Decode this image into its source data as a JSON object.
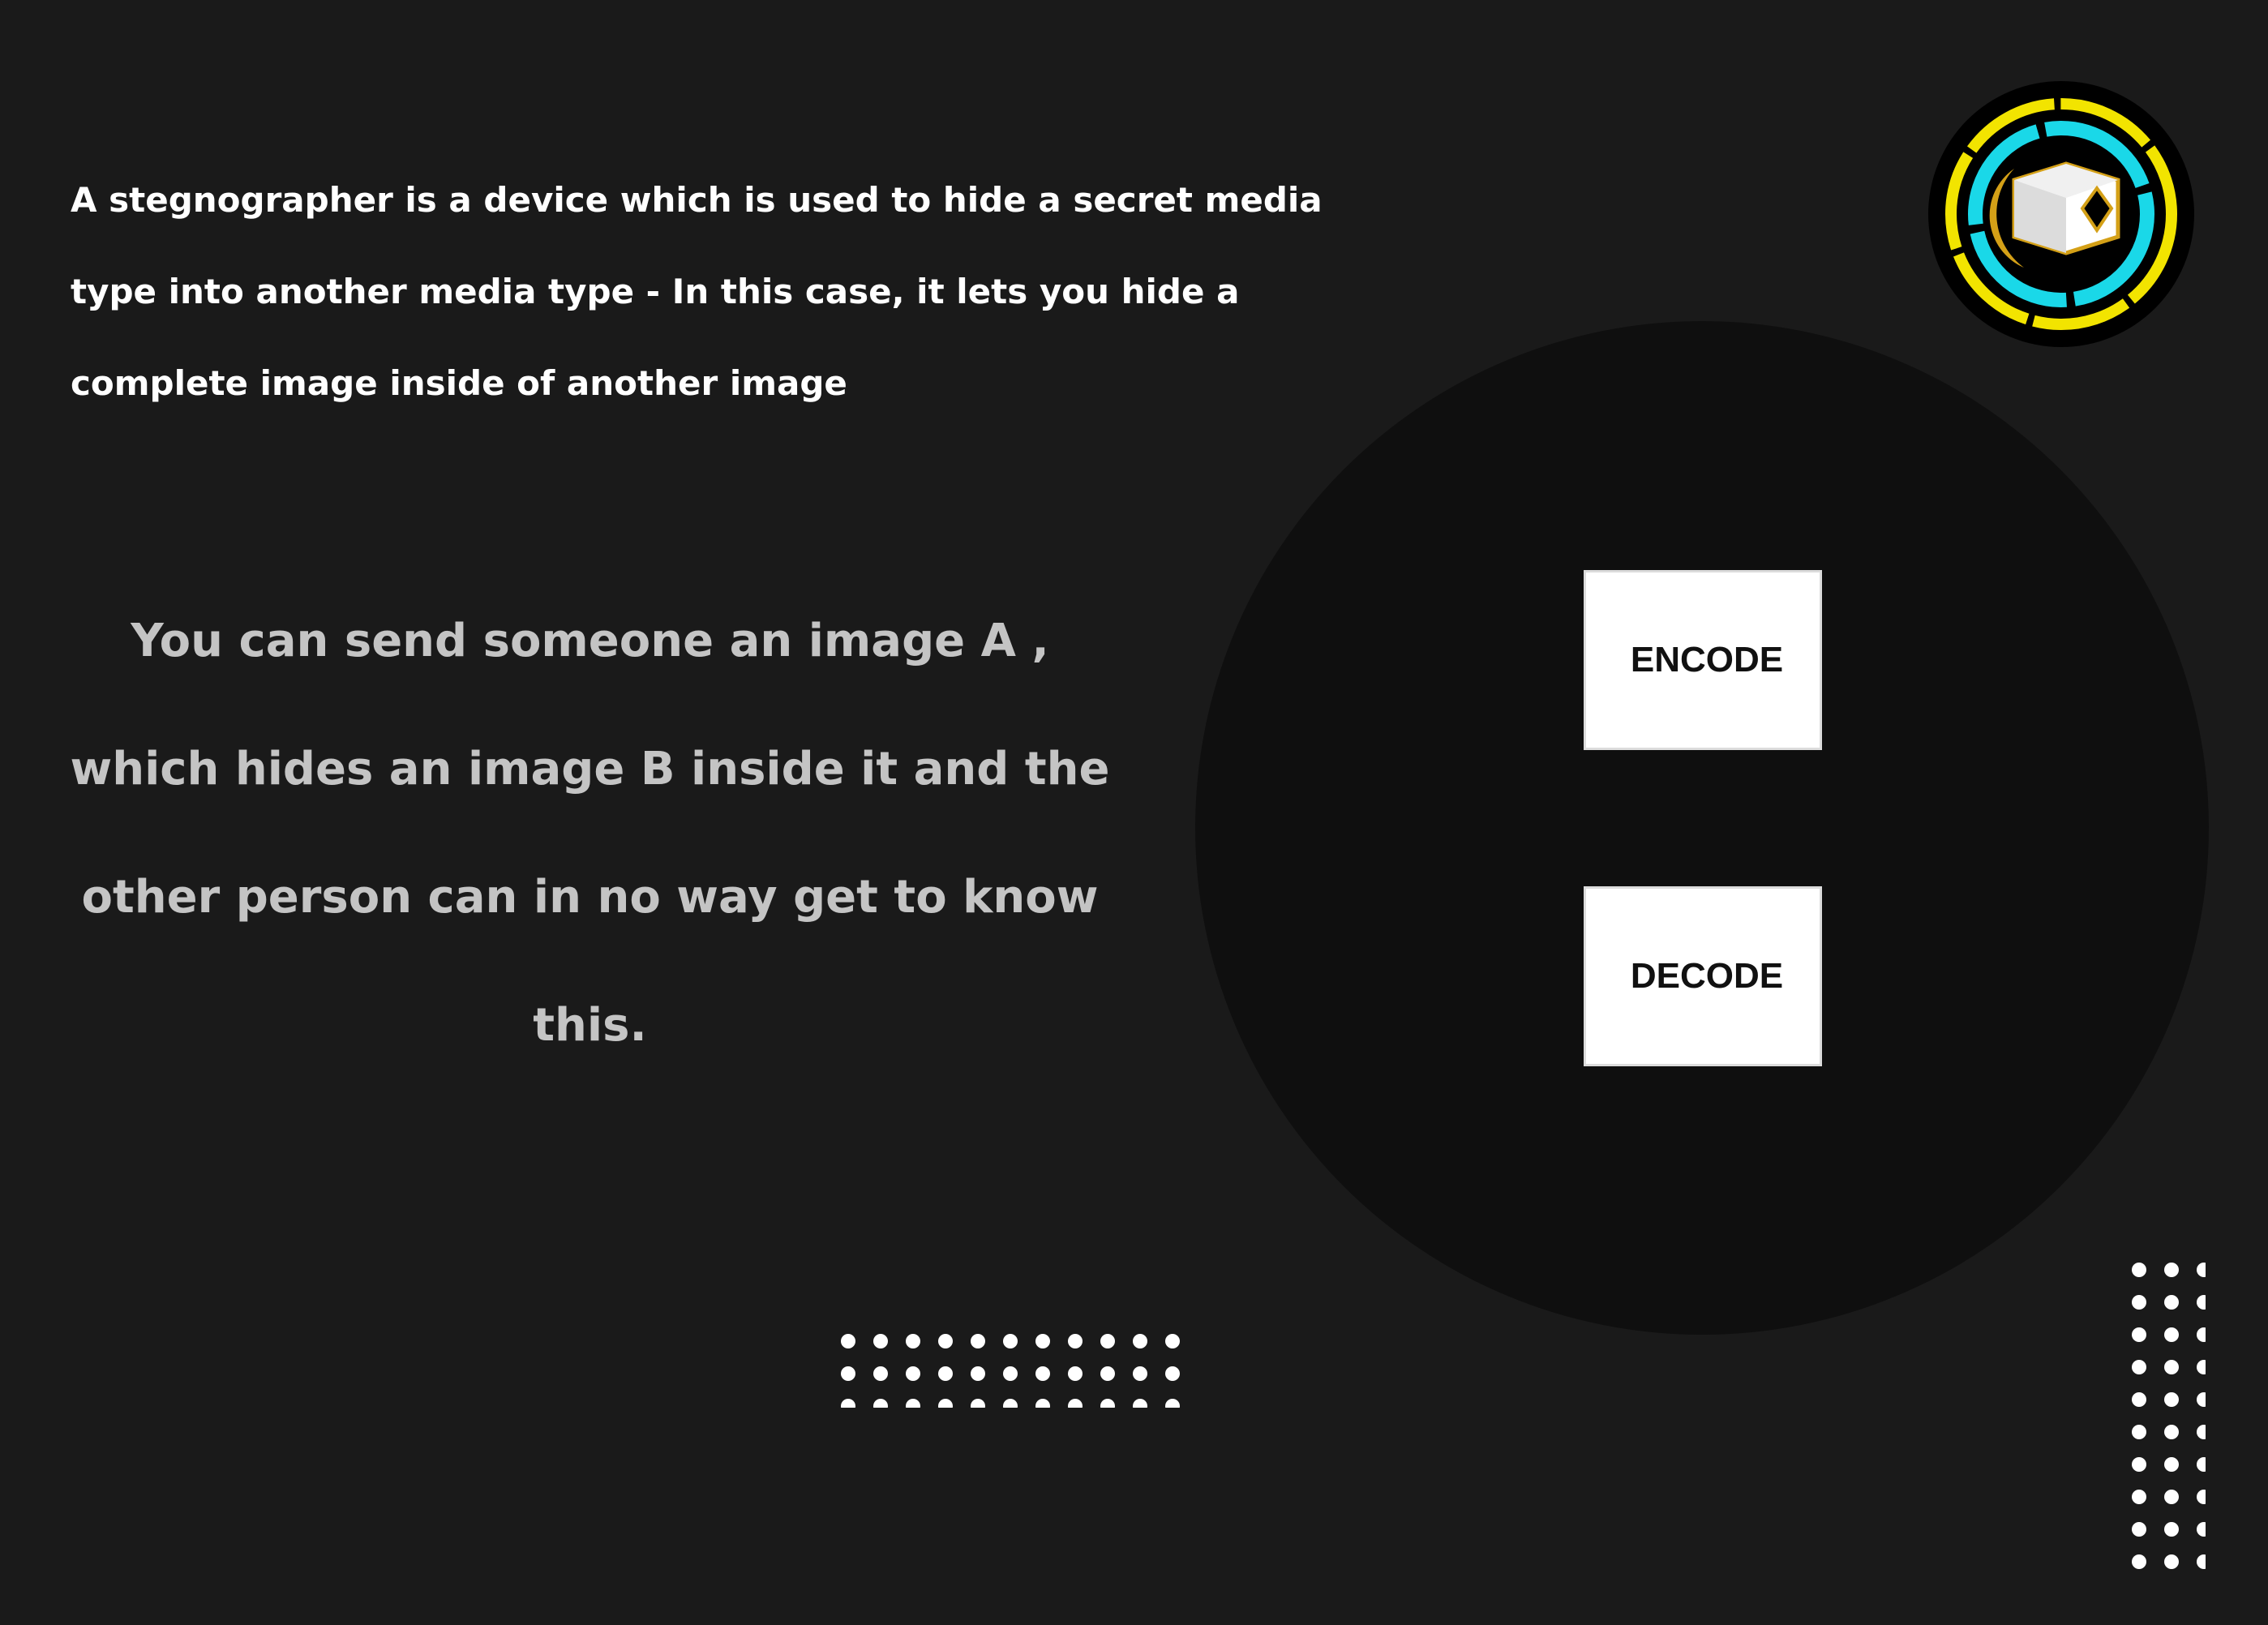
{
  "intro": {
    "text": "A stegnographer is a device which is used to hide a secret media type into another media type - In this case, it lets you hide a complete image inside of another image"
  },
  "tagline": {
    "text": "You can send someone an image A , which hides an image B inside it and the other person can in no way get to know this."
  },
  "actions": {
    "encode_label": "ENCODE",
    "decode_label": "DECODE"
  },
  "logo": {
    "icon": "cube-ring-logo-icon"
  },
  "colors": {
    "background": "#1a1a1a",
    "panel": "#0f0f0f",
    "logo_yellow": "#f2e400",
    "logo_cyan": "#1ad8e8",
    "logo_gold": "#d4a017",
    "text_primary": "#ffffff",
    "text_secondary": "#c4c4c4"
  }
}
